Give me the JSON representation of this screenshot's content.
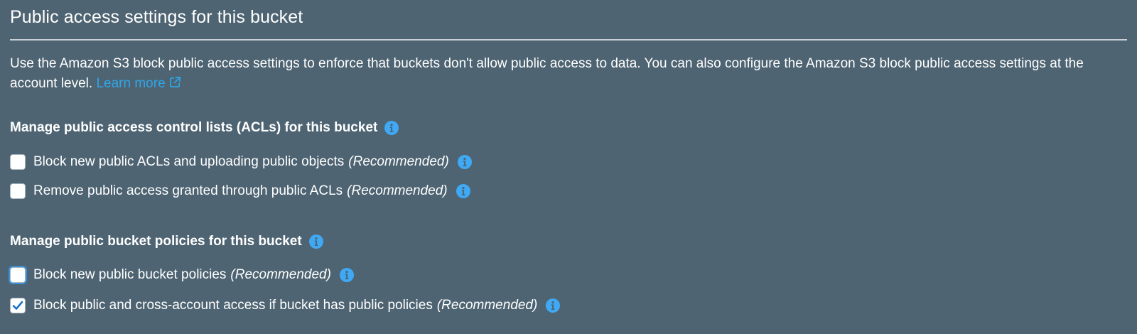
{
  "header": {
    "title": "Public access settings for this bucket"
  },
  "description": {
    "text": "Use the Amazon S3 block public access settings to enforce that buckets don't allow public access to data. You can also configure the Amazon S3 block public access settings at the account level.",
    "learn_more_label": "Learn more"
  },
  "acl_section": {
    "heading": "Manage public access control lists (ACLs) for this bucket",
    "options": [
      {
        "label": "Block new public ACLs and uploading public objects",
        "tag": "(Recommended)",
        "checked": false
      },
      {
        "label": "Remove public access granted through public ACLs",
        "tag": "(Recommended)",
        "checked": false
      }
    ]
  },
  "policy_section": {
    "heading": "Manage public bucket policies for this bucket",
    "options": [
      {
        "label": "Block new public bucket policies",
        "tag": "(Recommended)",
        "checked": false
      },
      {
        "label": "Block public and cross-account access if bucket has public policies",
        "tag": "(Recommended)",
        "checked": true
      }
    ]
  },
  "icons": {
    "info": "info-circle-icon",
    "external_link": "external-link-icon",
    "checkmark": "checkmark-icon"
  },
  "colors": {
    "background": "#4e6472",
    "link": "#2fa6e8",
    "info_icon": "#3fa9f5",
    "checkmark": "#1a73c8"
  }
}
